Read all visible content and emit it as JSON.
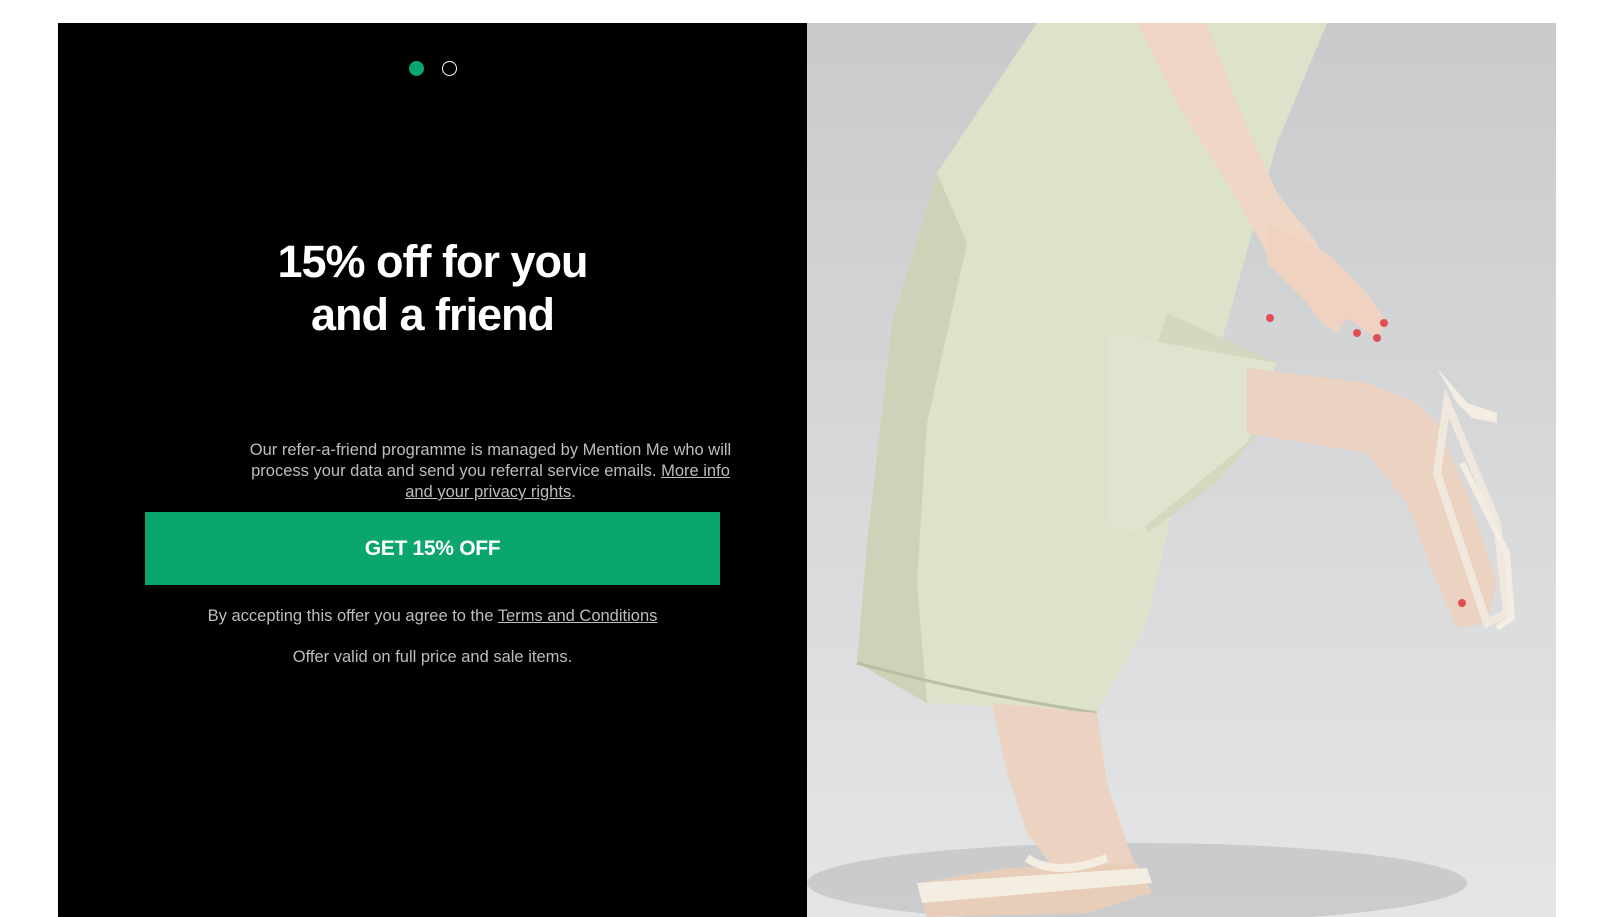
{
  "modal": {
    "pager": {
      "total": 2,
      "active_index": 0,
      "active_color": "#0aa66e"
    },
    "headline": {
      "line1": "15% off for you",
      "line2": "and a friend"
    },
    "privacy": {
      "text": "Our refer-a-friend programme is managed by Mention Me who will process your data and send you referral service emails.",
      "link": "More info and your privacy rights",
      "suffix": "."
    },
    "cta": {
      "label": "GET 15% OFF",
      "color": "#0aa66e"
    },
    "terms": {
      "text": "By accepting this offer you agree to the",
      "link": "Terms and Conditions"
    },
    "validity": "Offer valid on full price and sale items.",
    "image": {
      "subject": "model-wearing-cropped-trousers-and-kitten-heel-sandals"
    }
  }
}
